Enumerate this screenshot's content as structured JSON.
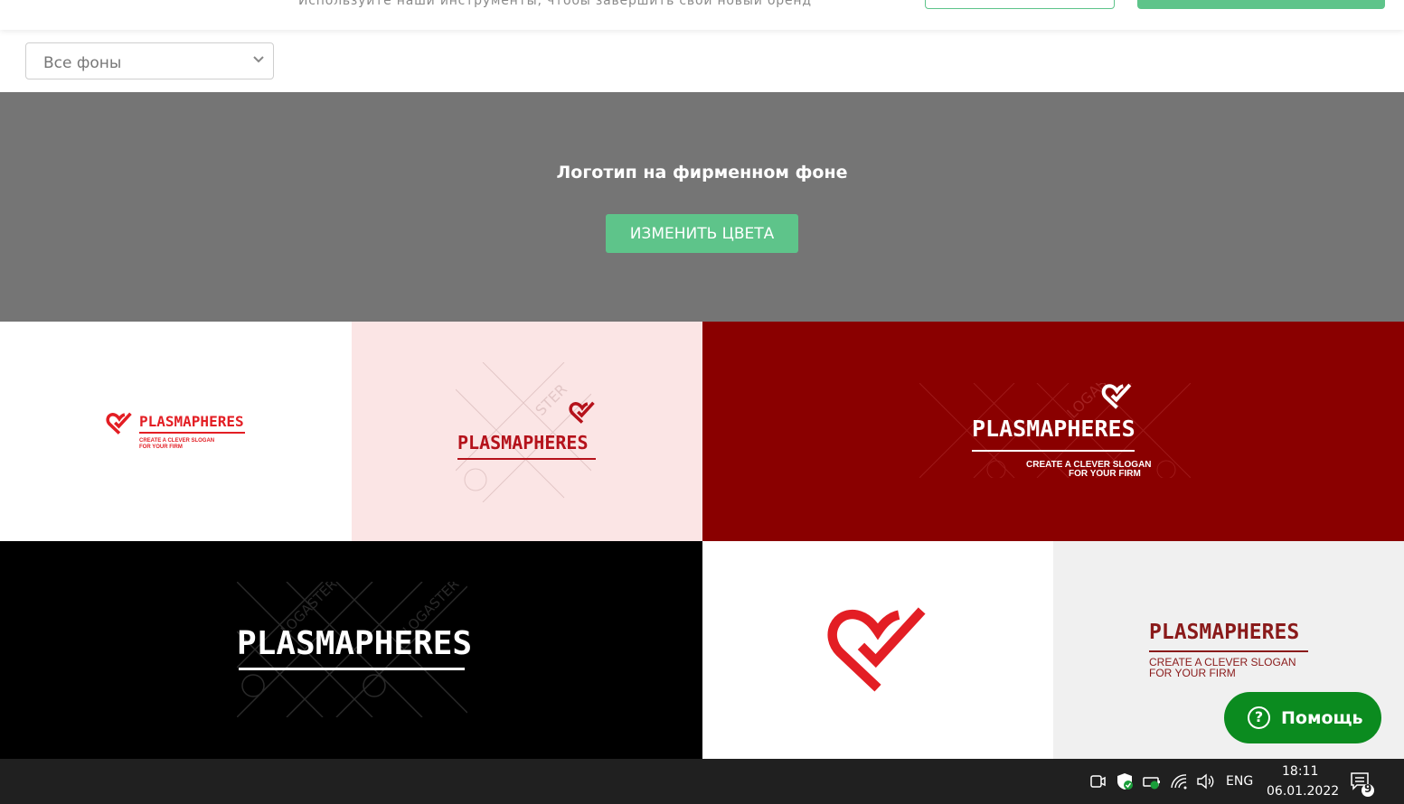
{
  "topbar": {
    "subtitle": "Используйте наши инструменты, чтобы завершить свой новый бренд"
  },
  "filter": {
    "selected": "Все фоны"
  },
  "banner": {
    "title": "Логотип на фирменном фоне",
    "button_label": "ИЗМЕНИТЬ ЦВЕТА"
  },
  "brand": {
    "name": "PLASMAPHERES",
    "slogan_line1": "CREATE A CLEVER SLOGAN",
    "slogan_line2": "FOR YOUR FIRM",
    "watermark": "LOGASTER",
    "colors": {
      "red": "#e31e24",
      "dark_red": "#8a0000",
      "pink_bg": "#fbe5e5",
      "light_gray_bg": "#f0f0f0",
      "black_bg": "#000000"
    }
  },
  "help": {
    "label": "Помощь"
  },
  "taskbar": {
    "language": "ENG",
    "time": "18:11",
    "date": "06.01.2022",
    "notifications": "9"
  }
}
